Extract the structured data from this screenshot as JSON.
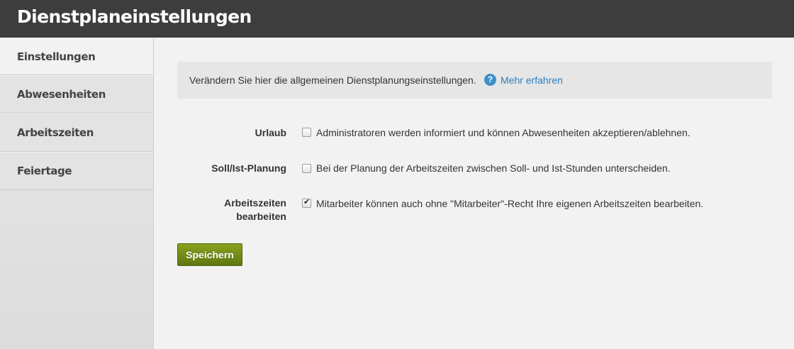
{
  "header": {
    "title": "Dienstplaneinstellungen"
  },
  "sidebar": {
    "items": [
      {
        "label": "Einstellungen",
        "active": true,
        "indicator": "›"
      },
      {
        "label": "Abwesenheiten"
      },
      {
        "label": "Arbeitszeiten"
      },
      {
        "label": "Feiertage"
      }
    ]
  },
  "info": {
    "text": "Verändern Sie hier die allgemeinen Dienstplanungseinstellungen.",
    "help_icon": "?",
    "link": "Mehr erfahren"
  },
  "settings": [
    {
      "label": "Urlaub",
      "checked": false,
      "description": "Administratoren werden informiert und können Abwesenheiten akzeptieren/ablehnen."
    },
    {
      "label": "Soll/Ist-Planung",
      "checked": false,
      "description": "Bei der Planung der Arbeitszeiten zwischen Soll- und Ist-Stunden unterscheiden."
    },
    {
      "label_line1": "Arbeitszeiten",
      "label_line2": "bearbeiten",
      "checked": true,
      "description": "Mitarbeiter können auch ohne \"Mitarbeiter\"-Recht Ihre eigenen Arbeitszeiten bearbeiten."
    }
  ],
  "actions": {
    "save_label": "Speichern"
  },
  "colors": {
    "header_bg": "#3d3d3d",
    "link": "#2a7fc1",
    "save_button": "#7a931a"
  }
}
